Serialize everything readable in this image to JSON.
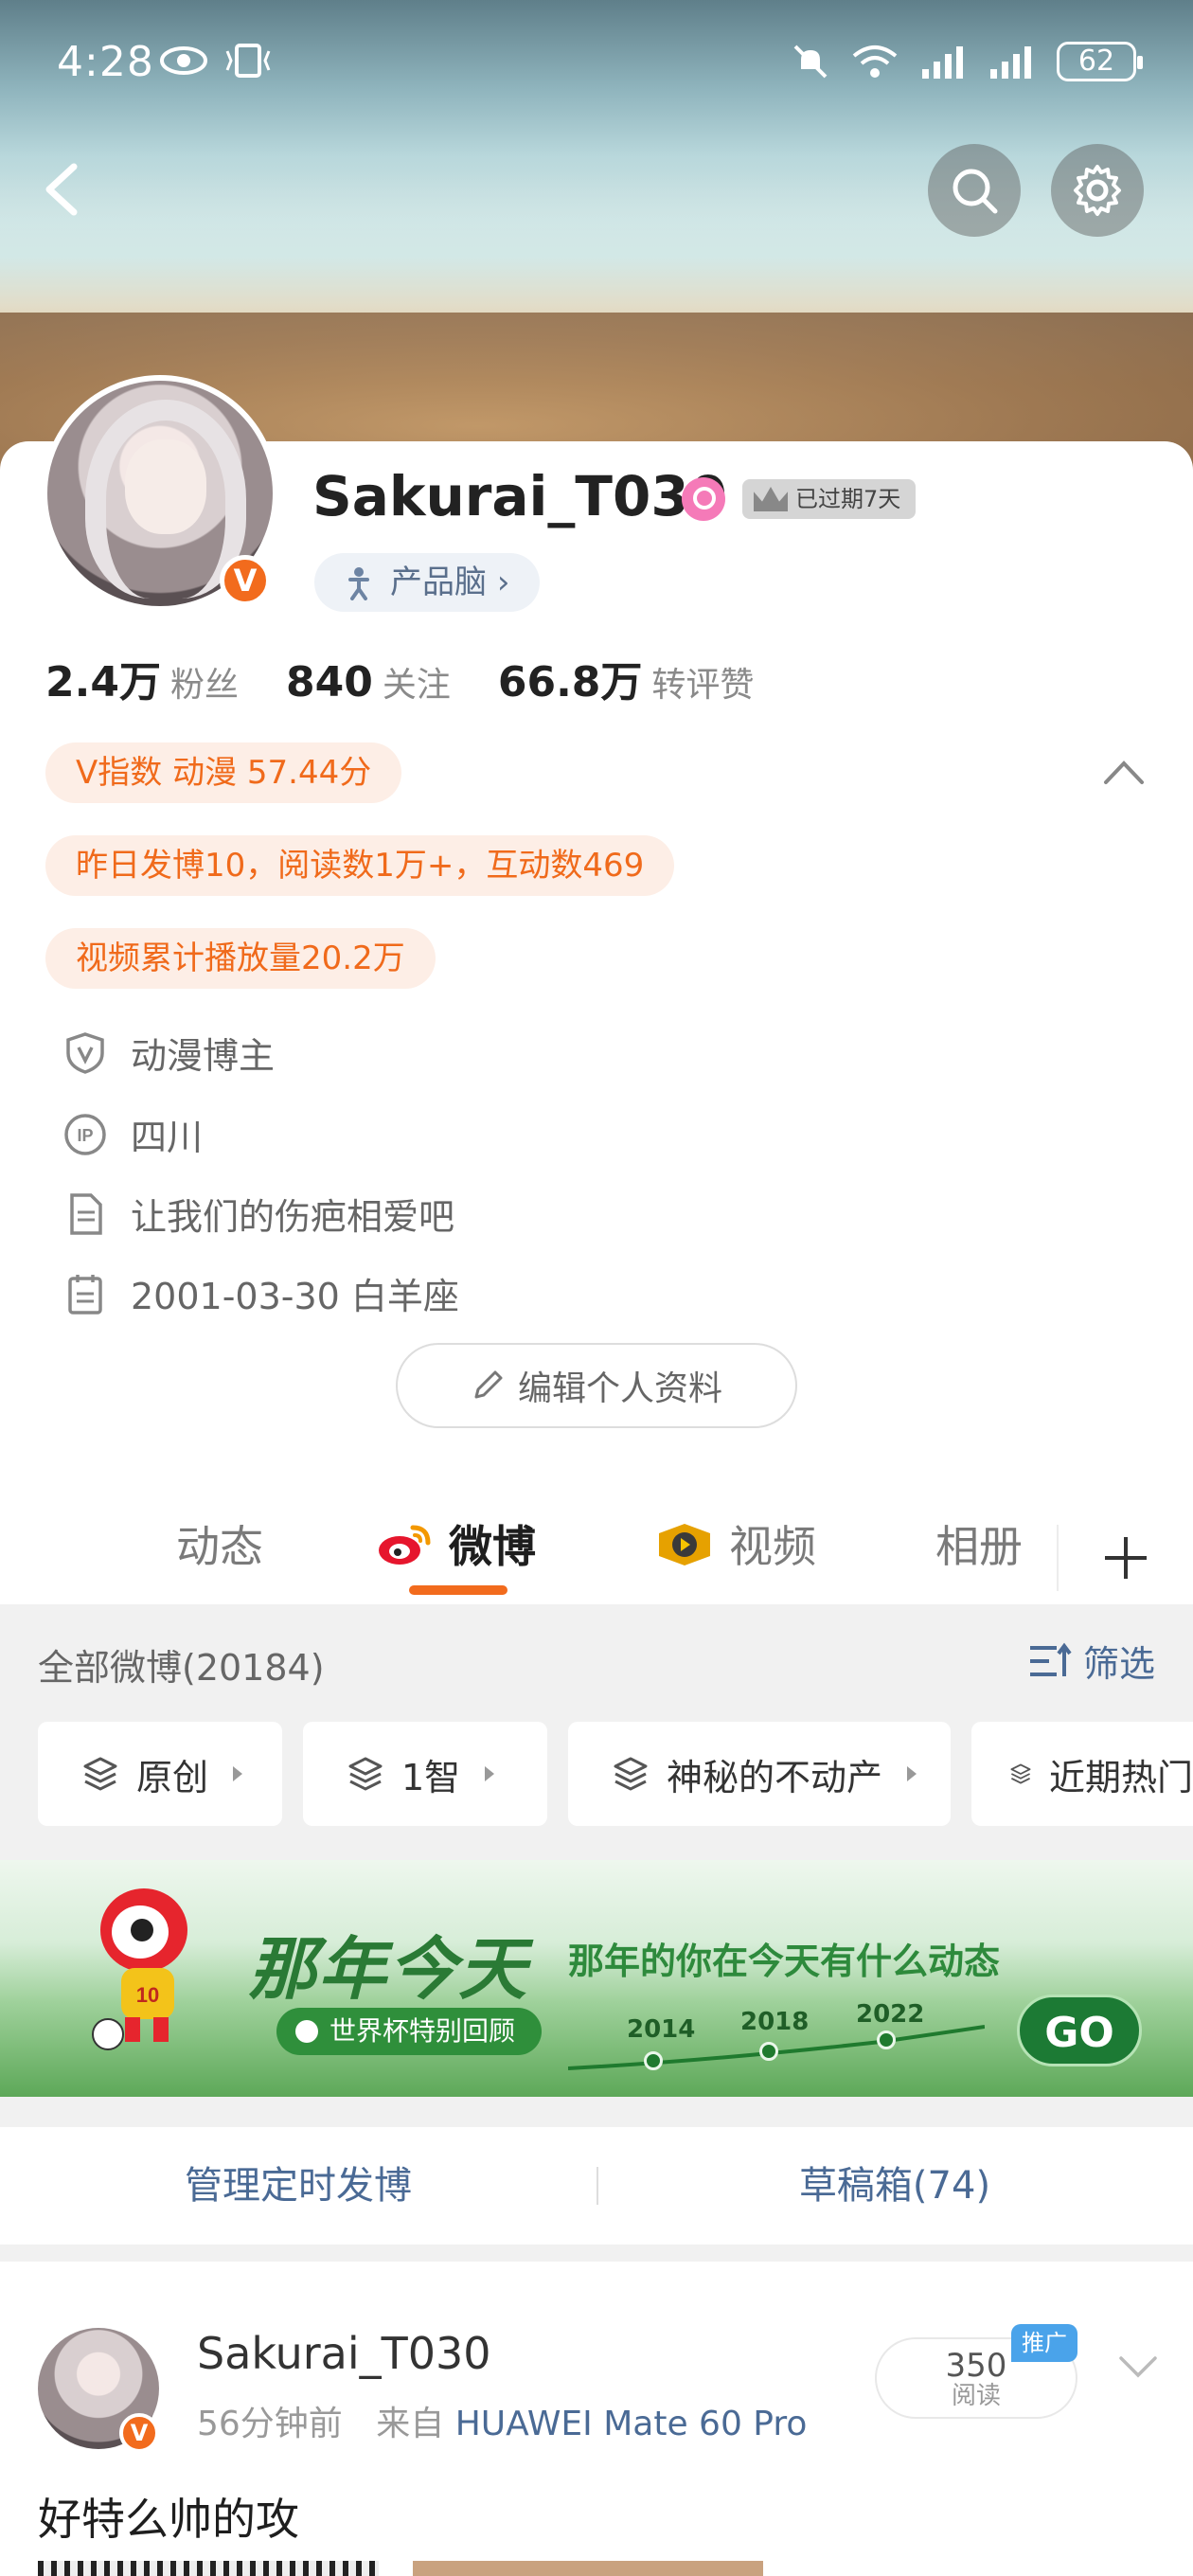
{
  "status_bar": {
    "time": "4:28",
    "battery": "62"
  },
  "profile": {
    "username": "Sakurai_T030",
    "member_badge": "已过期7天",
    "tag": "产品脑",
    "tag_chevron": "›",
    "verified_mark": "V"
  },
  "stats": [
    {
      "value": "2.4万",
      "label": "粉丝"
    },
    {
      "value": "840",
      "label": "关注"
    },
    {
      "value": "66.8万",
      "label": "转评赞"
    }
  ],
  "pills": {
    "v_index": "V指数 动漫 57.44分",
    "yesterday": "昨日发博10，阅读数1万+，互动数469",
    "video": "视频累计播放量20.2万"
  },
  "info": {
    "category": "动漫博主",
    "location": "四川",
    "bio": "让我们的伤疤相爱吧",
    "birthday": "2001-03-30 白羊座"
  },
  "edit_profile": "编辑个人资料",
  "tabs": [
    {
      "label": "动态"
    },
    {
      "label": "微博"
    },
    {
      "label": "视频"
    },
    {
      "label": "相册"
    }
  ],
  "feed": {
    "all_count": "全部微博(20184)",
    "filter": "筛选",
    "chips": [
      "原创",
      "1智",
      "神秘的不动产",
      "近期热门"
    ]
  },
  "promo": {
    "title": "那年今天",
    "subtitle": "那年的你在今天有什么动态",
    "chip": "世界杯特别回顾",
    "years": [
      "2014",
      "2018",
      "2022"
    ],
    "go": "GO"
  },
  "manage": {
    "scheduled": "管理定时发博",
    "drafts": "草稿箱(74)"
  },
  "post": {
    "author": "Sakurai_T030",
    "time": "56分钟前",
    "from_label": "来自",
    "source": "HUAWEI Mate 60 Pro",
    "read_count": "350",
    "read_label": "阅读",
    "promo_tag": "推广",
    "text": "好特么帅的攻",
    "verified_mark": "V"
  },
  "colors": {
    "accent": "#f26b1d",
    "link": "#4a6a95",
    "pill_bg": "#fdeee6"
  }
}
